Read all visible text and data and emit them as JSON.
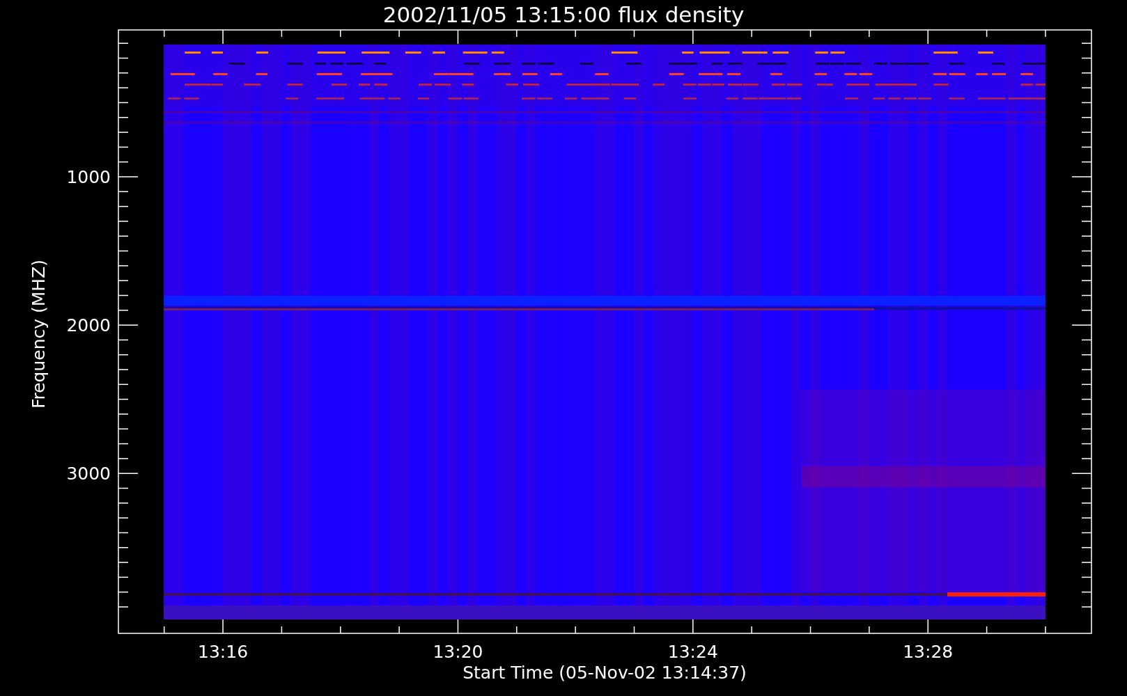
{
  "plot": {
    "title": "2002/11/05 13:15:00 flux density",
    "xlabel": "Start Time (05-Nov-02 13:14:37)",
    "ylabel": "Frequency (MHZ)",
    "xticks": [
      "13:16",
      "13:20",
      "13:24",
      "13:28"
    ],
    "yticks": [
      "1000",
      "2000",
      "3000"
    ]
  }
}
